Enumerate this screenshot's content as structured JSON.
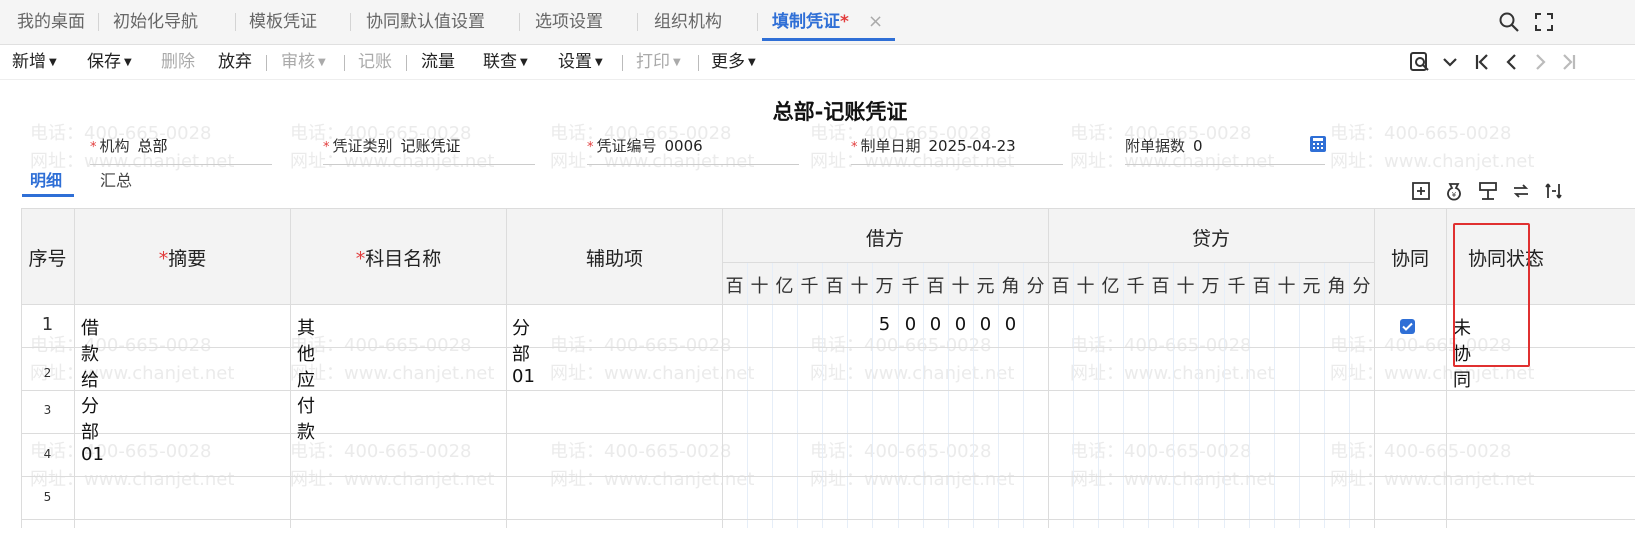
{
  "tabs": [
    {
      "label": "我的桌面",
      "active": false
    },
    {
      "label": "初始化导航",
      "active": false
    },
    {
      "label": "模板凭证",
      "active": false
    },
    {
      "label": "协同默认值设置",
      "active": false
    },
    {
      "label": "选项设置",
      "active": false
    },
    {
      "label": "组织机构",
      "active": false
    },
    {
      "label": "填制凭证",
      "active": true,
      "modified_mark": "*"
    }
  ],
  "tab_close_glyph": "×",
  "toolbar": {
    "new": "新增",
    "save": "保存",
    "delete": "删除",
    "abandon": "放弃",
    "audit": "审核",
    "post": "记账",
    "cashflow": "流量",
    "linked_query": "联查",
    "settings": "设置",
    "print": "打印",
    "more": "更多"
  },
  "voucher": {
    "title": "总部-记账凭证",
    "org_label": "机构",
    "org_value": "总部",
    "type_label": "凭证类别",
    "type_value": "记账凭证",
    "number_label": "凭证编号",
    "number_value": "0006",
    "date_label": "制单日期",
    "date_value": "2025-04-23",
    "attach_label": "附单据数",
    "attach_value": "0"
  },
  "subtabs": {
    "detail": "明细",
    "summary": "汇总"
  },
  "table": {
    "headers": {
      "seq": "序号",
      "summary": "摘要",
      "account": "科目名称",
      "aux": "辅助项",
      "debit": "借方",
      "credit": "贷方",
      "collab": "协同",
      "collab_status": "协同状态"
    },
    "required_mark": "*",
    "digit_units": [
      "百",
      "十",
      "亿",
      "千",
      "百",
      "十",
      "万",
      "千",
      "百",
      "十",
      "元",
      "角",
      "分"
    ],
    "rows": [
      {
        "no": "1",
        "summary": "借款给分部01",
        "account": "其他应付款",
        "aux": "分部01",
        "debit_digits": [
          "5",
          "0",
          "0",
          "0",
          "0",
          "0"
        ],
        "collab_checked": true,
        "status": "未协同"
      },
      {
        "no": "2"
      },
      {
        "no": "3"
      },
      {
        "no": "4"
      },
      {
        "no": "5"
      }
    ]
  },
  "watermark": {
    "phone": "电话：400-665-0028",
    "site": "网址：www.chanjet.net"
  },
  "colors": {
    "accent": "#2f6fd6",
    "required": "#e23c3c",
    "highlight_box": "#e03030"
  }
}
